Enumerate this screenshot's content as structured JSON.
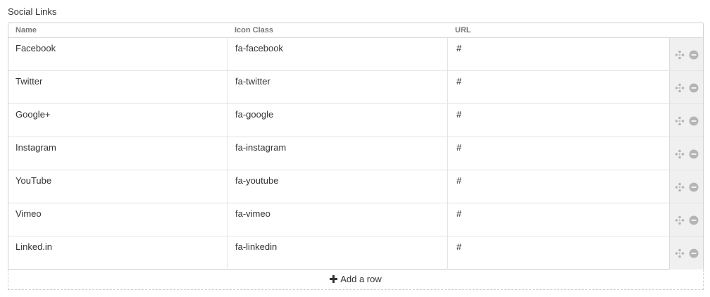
{
  "field": {
    "title": "Social Links"
  },
  "grid": {
    "columns": [
      "Name",
      "Icon Class",
      "URL"
    ],
    "rows": [
      {
        "name": "Facebook",
        "icon_class": "fa-facebook",
        "url": "#"
      },
      {
        "name": "Twitter",
        "icon_class": "fa-twitter",
        "url": "#"
      },
      {
        "name": "Google+",
        "icon_class": "fa-google",
        "url": "#"
      },
      {
        "name": "Instagram",
        "icon_class": "fa-instagram",
        "url": "#"
      },
      {
        "name": "YouTube",
        "icon_class": "fa-youtube",
        "url": "#"
      },
      {
        "name": "Vimeo",
        "icon_class": "fa-vimeo",
        "url": "#"
      },
      {
        "name": "Linked.in",
        "icon_class": "fa-linkedin",
        "url": "#"
      }
    ],
    "row_actions": {
      "move_icon": "move-icon",
      "remove_icon": "minus-circle-icon"
    }
  },
  "footer": {
    "add_row_label": "Add a row",
    "add_row_icon": "plus-icon"
  },
  "colors": {
    "border": "#cfcfcf",
    "action_bg": "#f0f0f0",
    "icon_gray": "#b5b5b5",
    "text": "#333333",
    "header_text": "#7a7a7a"
  }
}
